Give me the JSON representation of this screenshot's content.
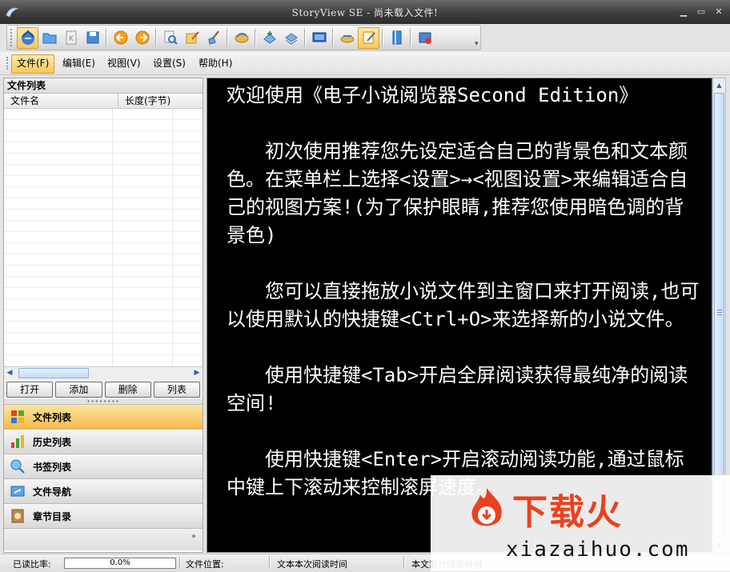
{
  "window": {
    "title": "StoryView SE - 尚未载入文件!"
  },
  "menu": [
    {
      "label": "文件(F)",
      "active": true
    },
    {
      "label": "编辑(E)"
    },
    {
      "label": "视图(V)"
    },
    {
      "label": "设置(S)"
    },
    {
      "label": "帮助(H)"
    }
  ],
  "file_panel": {
    "title": "文件列表",
    "columns": [
      "文件名",
      "长度(字节)"
    ],
    "buttons": {
      "open": "打开",
      "add": "添加",
      "delete": "删除",
      "list": "列表"
    }
  },
  "nav": [
    {
      "label": "文件列表",
      "active": true
    },
    {
      "label": "历史列表"
    },
    {
      "label": "书签列表"
    },
    {
      "label": "文件导航"
    },
    {
      "label": "章节目录"
    }
  ],
  "reader": {
    "paragraphs": [
      "欢迎使用《电子小说阅览器Second Edition》",
      "初次使用推荐您先设定适合自己的背景色和文本颜色。在菜单栏上选择<设置>→<视图设置>来编辑适合自己的视图方案!(为了保护眼睛,推荐您使用暗色调的背景色)",
      "您可以直接拖放小说文件到主窗口来打开阅读,也可以使用默认的快捷键<Ctrl+O>来选择新的小说文件。",
      "使用快捷键<Tab>开启全屏阅读获得最纯净的阅读空间!",
      "使用快捷键<Enter>开启滚动阅读功能,通过鼠标中键上下滚动来控制滚屏速度。"
    ]
  },
  "status": {
    "read_ratio_label": "已读比率:",
    "read_ratio_value": "0.0%",
    "read_ratio_fraction": 0.0,
    "file_position_label": "文件位置:",
    "session_time_label": "文本本次阅读时间",
    "total_time_label": "本文累计阅读时间"
  },
  "watermark": {
    "brand": "下载火",
    "url": "xiazaihuo.com"
  },
  "colors": {
    "accent": "#f7b94a",
    "reader_bg": "#000000",
    "reader_fg": "#ffffff",
    "brand": "#e9421e"
  }
}
